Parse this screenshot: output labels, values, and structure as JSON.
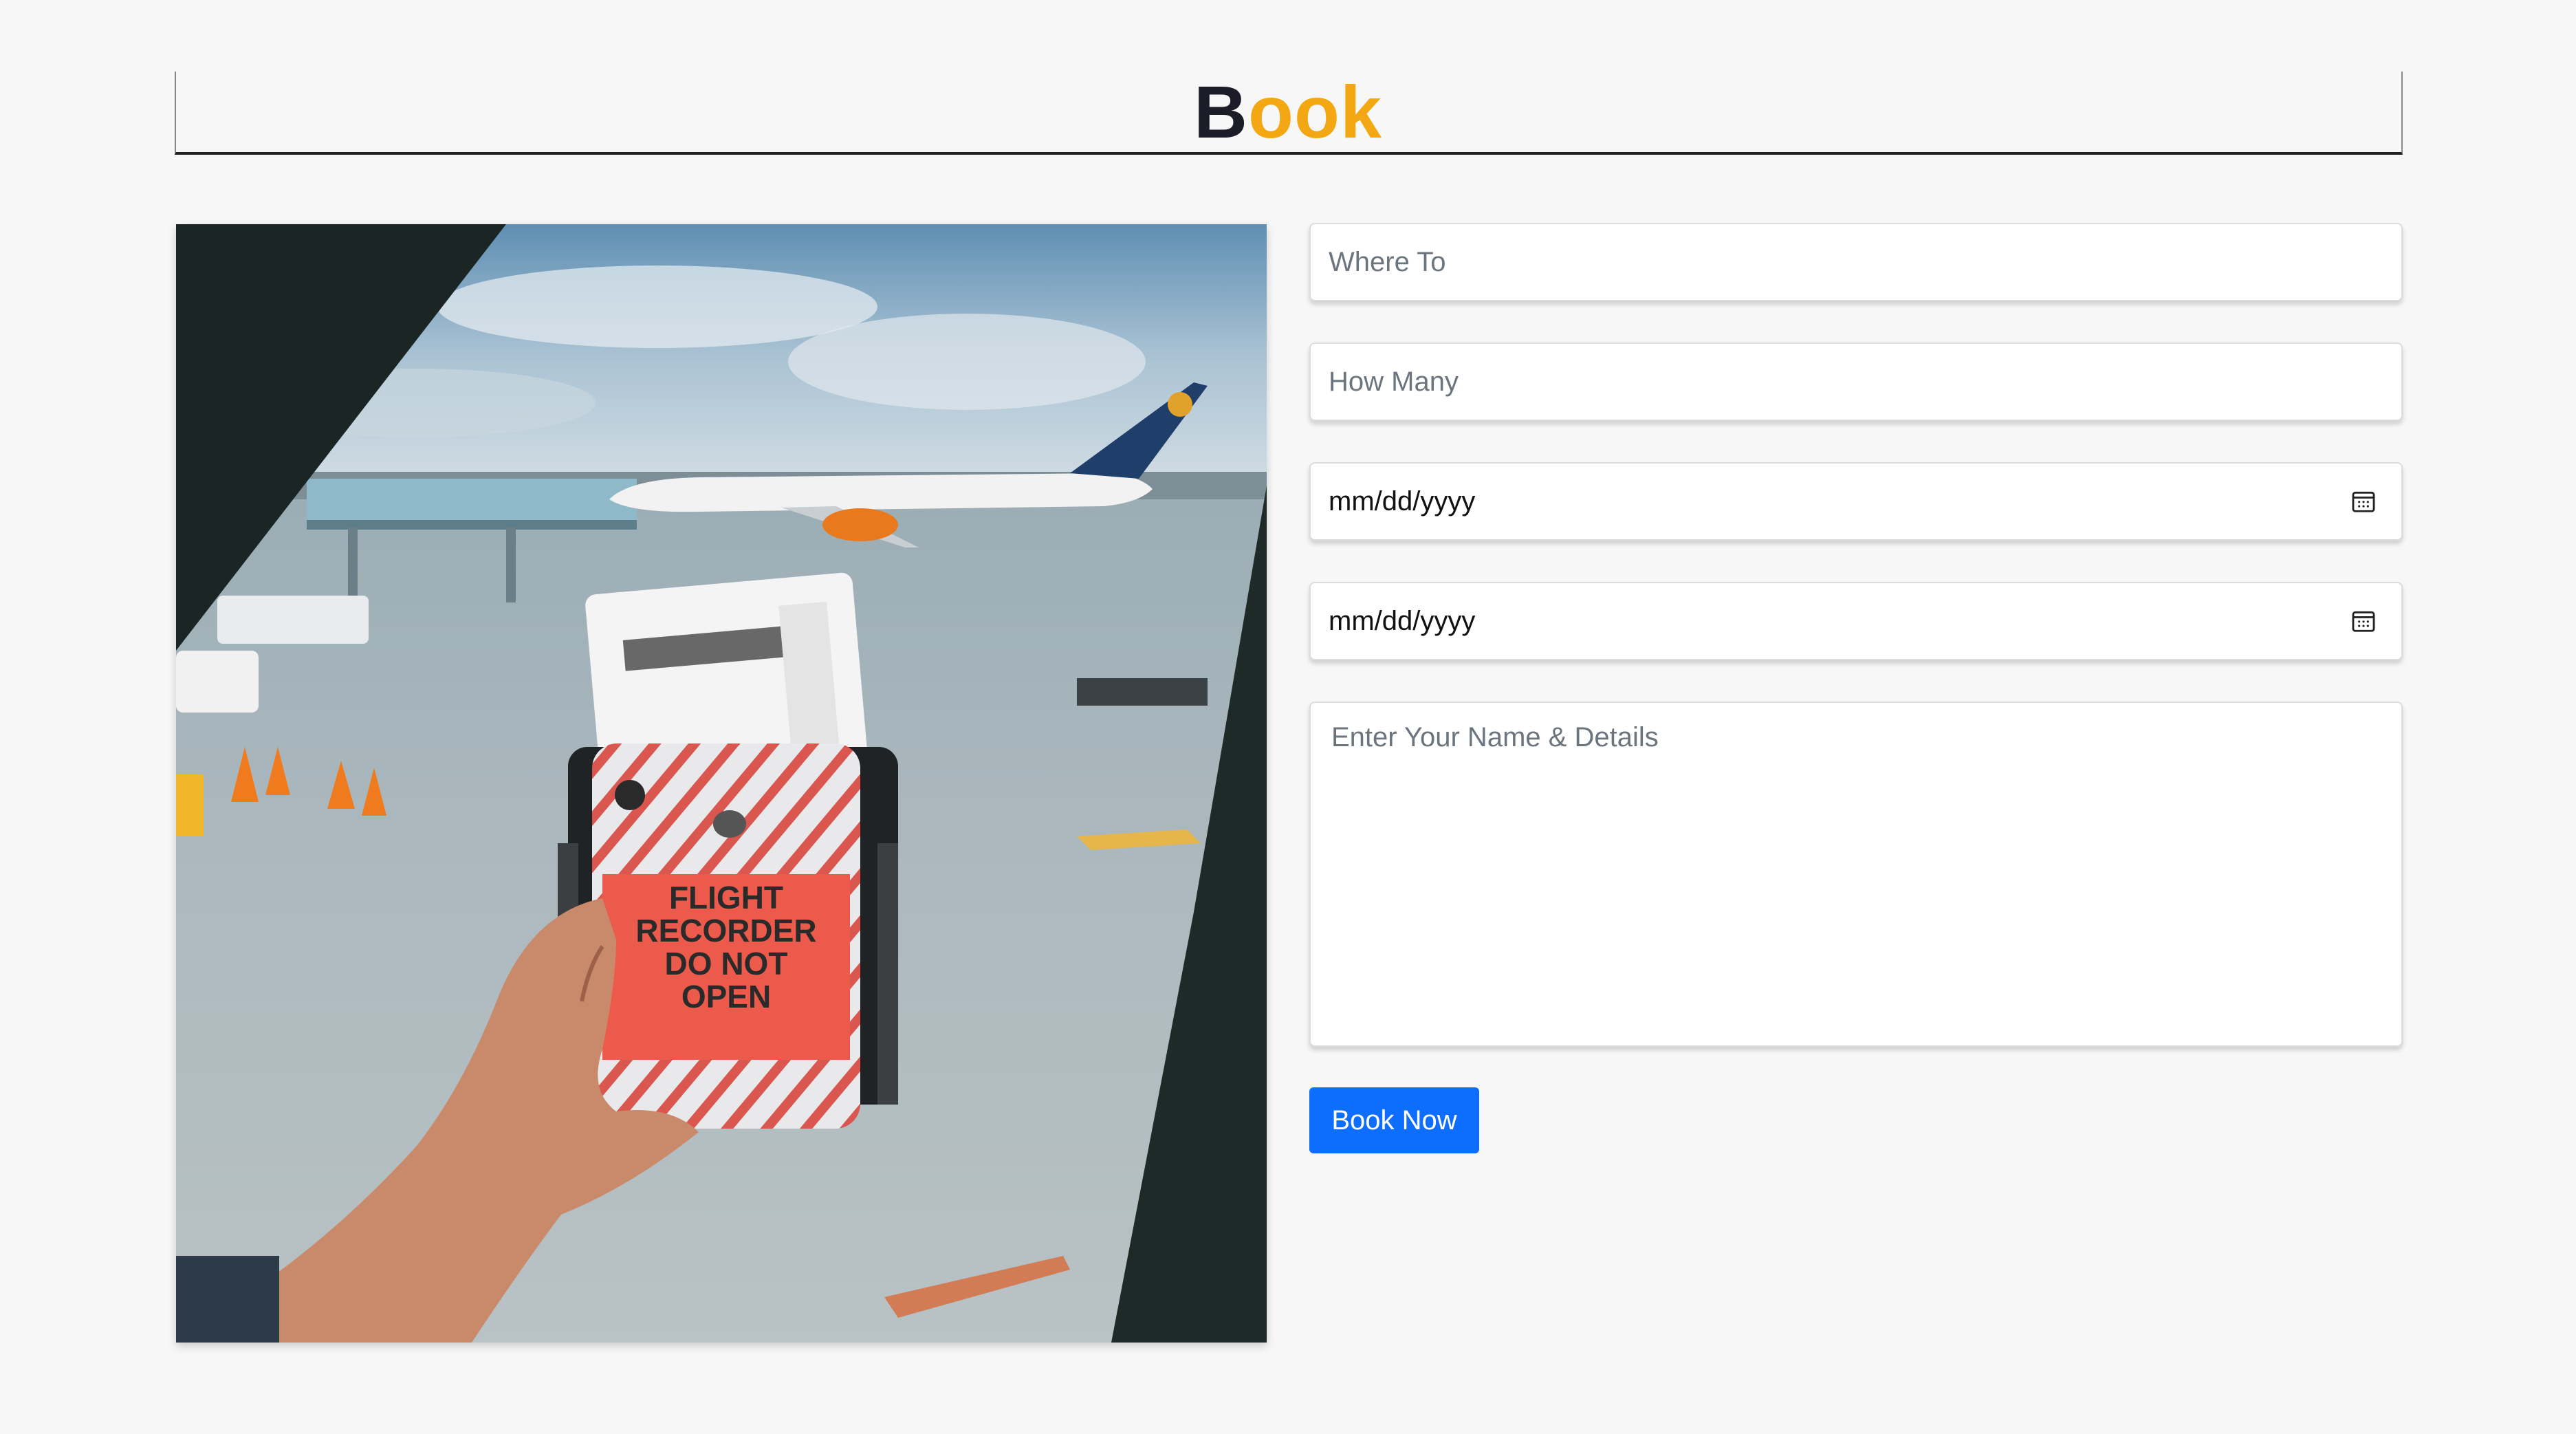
{
  "header": {
    "title_first": "B",
    "title_rest": "ook"
  },
  "photo": {
    "alt": "Hand holding a phone in a case printed FLIGHT RECORDER DO NOT OPEN with a boarding pass, in front of an airport window with a jet on a wet apron",
    "case_text": [
      "FLIGHT",
      "RECORDER",
      "DO NOT",
      "OPEN"
    ]
  },
  "form": {
    "where_placeholder": "Where To",
    "how_many_placeholder": "How Many",
    "arrival_date": "mm/dd/yyyy",
    "leaving_date": "mm/dd/yyyy",
    "details_placeholder": "Enter Your Name & Details",
    "submit_label": "Book Now"
  },
  "colors": {
    "accent": "#f3a712",
    "button": "#0d6efd",
    "title_dark": "#1c1c28"
  },
  "icons": {
    "date_icon": "calendar-icon"
  }
}
